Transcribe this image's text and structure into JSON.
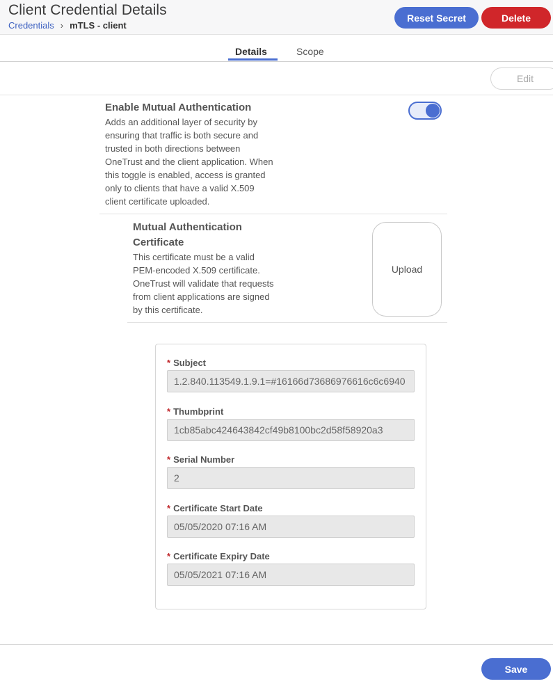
{
  "header": {
    "title": "Client Credential Details",
    "breadcrumb": {
      "link": "Credentials",
      "separator": "›",
      "current": "mTLS - client"
    },
    "reset_secret_label": "Reset Secret",
    "delete_label": "Delete"
  },
  "tabs": [
    {
      "label": "Details",
      "active": true
    },
    {
      "label": "Scope",
      "active": false
    }
  ],
  "toolbar": {
    "edit_label": "Edit"
  },
  "mutual_auth": {
    "title": "Enable Mutual Authentication",
    "description": "Adds an additional layer of security by ensuring that traffic is both secure and trusted in both directions between OneTrust and the client application. When this toggle is enabled, access is granted only to clients that have a valid X.509 client certificate uploaded.",
    "enabled": true
  },
  "certificate": {
    "title": "Mutual Authentication Certificate",
    "description": "This certificate must be a valid PEM-encoded X.509 certificate. OneTrust will validate that requests from client applications are signed by this certificate.",
    "upload_label": "Upload"
  },
  "fields": [
    {
      "label": "Subject",
      "value": "1.2.840.113549.1.9.1=#16166d73686976616c6c6940"
    },
    {
      "label": "Thumbprint",
      "value": "1cb85abc424643842cf49b8100bc2d58f58920a3"
    },
    {
      "label": "Serial Number",
      "value": "2"
    },
    {
      "label": "Certificate Start Date",
      "value": "05/05/2020 07:16 AM"
    },
    {
      "label": "Certificate Expiry Date",
      "value": "05/05/2021 07:16 AM"
    }
  ],
  "required_marker": "*",
  "footer": {
    "save_label": "Save"
  },
  "colors": {
    "primary": "#4a6ed1",
    "danger": "#d0262a",
    "required": "#c0262a"
  }
}
